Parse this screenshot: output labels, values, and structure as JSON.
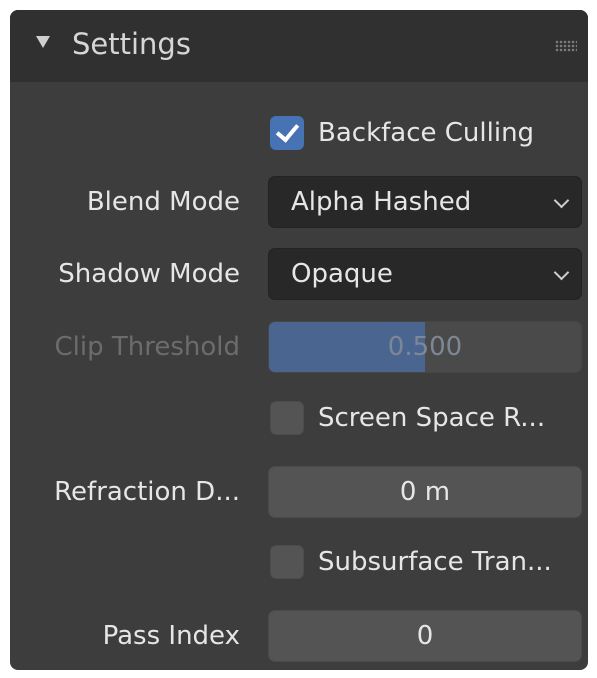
{
  "panel": {
    "title": "Settings"
  },
  "backface_culling": {
    "label": "Backface Culling",
    "checked": true
  },
  "blend_mode": {
    "label": "Blend Mode",
    "value": "Alpha Hashed"
  },
  "shadow_mode": {
    "label": "Shadow Mode",
    "value": "Opaque"
  },
  "clip_threshold": {
    "label": "Clip Threshold",
    "value": "0.500",
    "fraction": 0.5,
    "enabled": false
  },
  "screen_space_refraction": {
    "label": "Screen Space R...",
    "checked": false
  },
  "refraction_depth": {
    "label": "Refraction D...",
    "value": "0 m"
  },
  "subsurface_translucency": {
    "label": "Subsurface Tran...",
    "checked": false
  },
  "pass_index": {
    "label": "Pass Index",
    "value": "0"
  },
  "colors": {
    "panel_bg": "#3d3d3d",
    "header_bg": "#303030",
    "accent": "#4772b3",
    "slider_fill": "#4a6590"
  },
  "icons": {
    "collapse": "triangle-down",
    "drag": "grip-dots",
    "dropdown": "chevron-down",
    "check": "checkmark"
  }
}
